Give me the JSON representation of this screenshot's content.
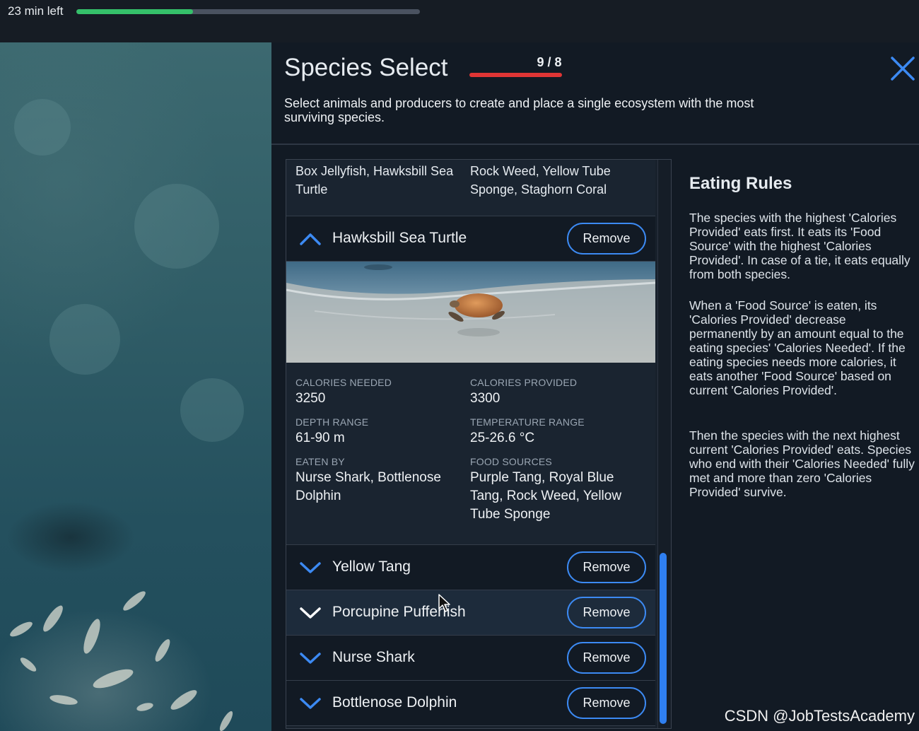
{
  "topbar": {
    "time_left": "23 min left",
    "progress": 0.34
  },
  "panel": {
    "title": "Species Select",
    "count": "9 / 8",
    "subtitle": "Select animals and producers to create and place a single ecosystem with the most surviving species."
  },
  "partial_row": {
    "col1": "Box Jellyfish, Hawksbill Sea Turtle",
    "col2": "Rock Weed, Yellow Tube Sponge, Staghorn Coral"
  },
  "expanded": {
    "name": "Hawksbill Sea Turtle",
    "remove_label": "Remove",
    "stats": {
      "calories_needed": {
        "label": "CALORIES NEEDED",
        "value": "3250"
      },
      "calories_provided": {
        "label": "CALORIES PROVIDED",
        "value": "3300"
      },
      "depth_range": {
        "label": "DEPTH RANGE",
        "value": "61-90 m"
      },
      "temperature_range": {
        "label": "TEMPERATURE RANGE",
        "value": "25-26.6 °C"
      },
      "eaten_by": {
        "label": "EATEN BY",
        "value": "Nurse Shark, Bottlenose Dolphin"
      },
      "food_sources": {
        "label": "FOOD SOURCES",
        "value": "Purple Tang, Royal Blue Tang, Rock Weed, Yellow Tube Sponge"
      }
    }
  },
  "species": [
    {
      "name": "Yellow Tang",
      "remove_label": "Remove"
    },
    {
      "name": "Porcupine Pufferfish",
      "remove_label": "Remove"
    },
    {
      "name": "Nurse Shark",
      "remove_label": "Remove"
    },
    {
      "name": "Bottlenose Dolphin",
      "remove_label": "Remove"
    }
  ],
  "rules": {
    "title": "Eating Rules",
    "p1": "The species with the highest 'Calories Provided' eats first. It eats its 'Food Source' with the highest 'Calories Provided'. In case of a tie, it eats equally from both species.",
    "p2": "When a 'Food Source' is eaten, its 'Calories Provided' decrease permanently by an amount equal to the eating species' 'Calories Needed'. If the eating species needs more calories, it eats another 'Food Source' based on current 'Calories Provided'.",
    "p3": "Then the species with the next highest current 'Calories Provided' eats. Species who end with their 'Calories Needed' fully met and more than zero 'Calories Provided' survive."
  },
  "watermark": "CSDN @JobTestsAcademy"
}
